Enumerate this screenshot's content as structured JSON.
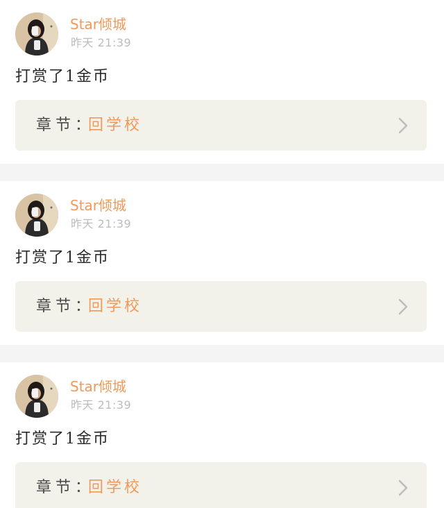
{
  "feed": {
    "items": [
      {
        "user_name": "Star倾城",
        "timestamp": "昨天 21:39",
        "message": "打赏了1金币",
        "chapter_label": "章节：",
        "chapter_title": "回学校"
      },
      {
        "user_name": "Star倾城",
        "timestamp": "昨天 21:39",
        "message": "打赏了1金币",
        "chapter_label": "章节：",
        "chapter_title": "回学校"
      },
      {
        "user_name": "Star倾城",
        "timestamp": "昨天 21:39",
        "message": "打赏了1金币",
        "chapter_label": "章节：",
        "chapter_title": "回学校"
      }
    ]
  },
  "colors": {
    "accent": "#f0995a",
    "chapter_bg": "#f3f2ea",
    "divider": "#f4f4f4",
    "timestamp": "#bcbcbc"
  },
  "icons": {
    "chevron": "chevron-right-icon",
    "avatar": "avatar"
  }
}
